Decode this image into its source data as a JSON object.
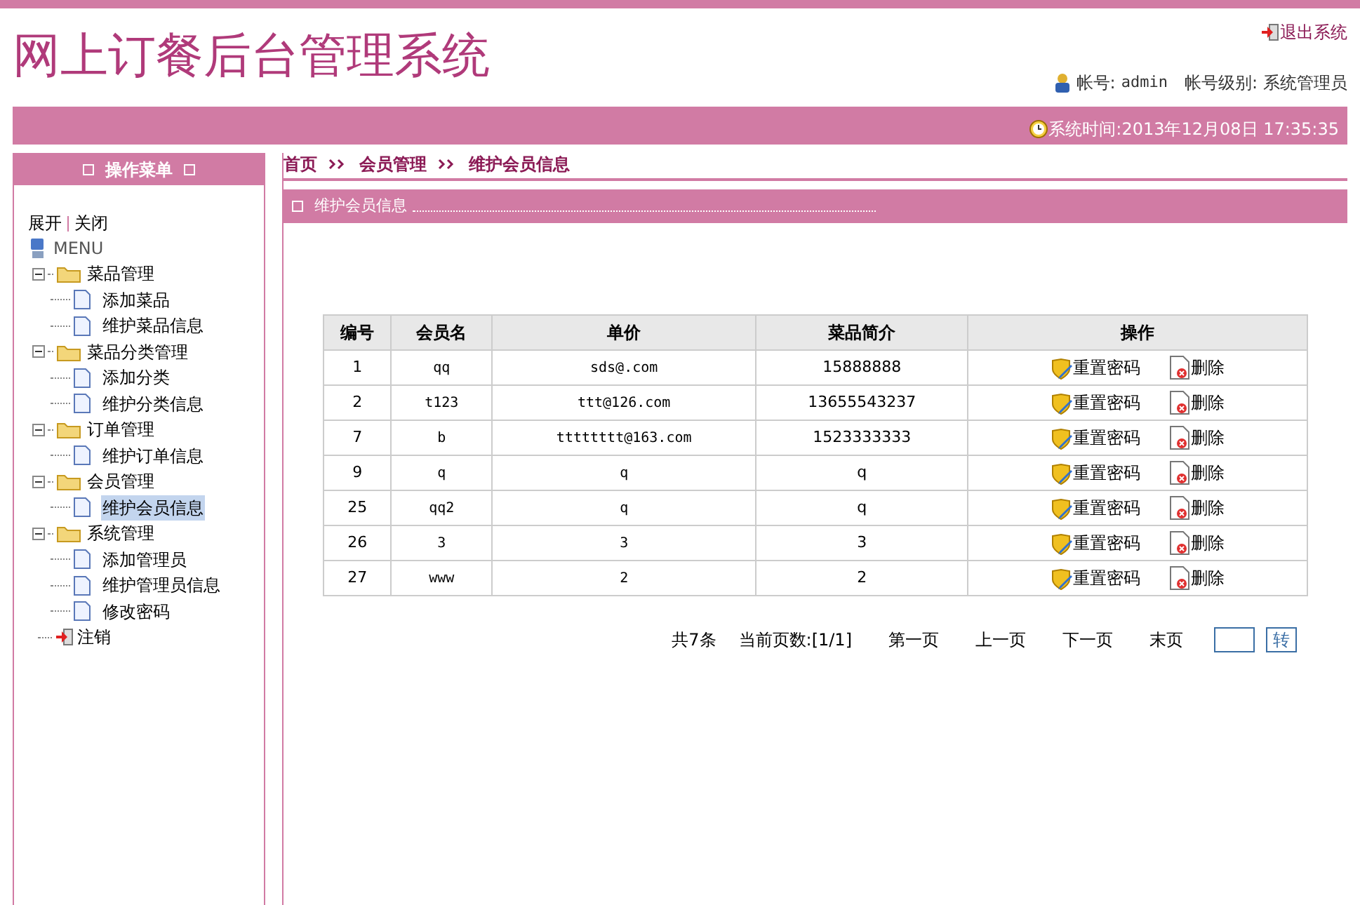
{
  "header": {
    "title": "网上订餐后台管理系统",
    "logout": "退出系统",
    "account_label": "帐号:",
    "account": "admin",
    "level_label": "帐号级别:",
    "level_value": "系统管理员",
    "time": "系统时间:2013年12月08日 17:35:35"
  },
  "sidebar": {
    "title": "操作菜单",
    "expand": "展开",
    "collapse": "关闭",
    "root": "MENU",
    "items": [
      {
        "label": "菜品管理",
        "kind": "folder",
        "expanded": true,
        "children": [
          {
            "label": "添加菜品",
            "selected": false
          },
          {
            "label": "维护菜品信息",
            "selected": false
          }
        ]
      },
      {
        "label": "菜品分类管理",
        "kind": "folder",
        "expanded": true,
        "children": [
          {
            "label": "添加分类",
            "selected": false
          },
          {
            "label": "维护分类信息",
            "selected": false
          }
        ]
      },
      {
        "label": "订单管理",
        "kind": "folder",
        "expanded": true,
        "children": [
          {
            "label": "维护订单信息",
            "selected": false
          }
        ]
      },
      {
        "label": "会员管理",
        "kind": "folder",
        "expanded": true,
        "children": [
          {
            "label": "维护会员信息",
            "selected": true
          }
        ]
      },
      {
        "label": "系统管理",
        "kind": "folder",
        "expanded": true,
        "children": [
          {
            "label": "添加管理员",
            "selected": false
          },
          {
            "label": "维护管理员信息",
            "selected": false
          },
          {
            "label": "修改密码",
            "selected": false
          }
        ]
      },
      {
        "label": "注销",
        "kind": "logout"
      }
    ]
  },
  "breadcrumb": [
    "首页",
    "会员管理",
    "维护会员信息"
  ],
  "panel": {
    "title": "维护会员信息"
  },
  "table": {
    "columns": [
      "编号",
      "会员名",
      "单价",
      "菜品简介",
      "操作"
    ],
    "rows": [
      {
        "cells": [
          "1",
          "qq",
          "sds@.com",
          "15888888"
        ],
        "actions": [
          "重置密码",
          "删除"
        ]
      },
      {
        "cells": [
          "2",
          "t123",
          "ttt@126.com",
          "13655543237"
        ],
        "actions": [
          "重置密码",
          "删除"
        ]
      },
      {
        "cells": [
          "7",
          "b",
          "tttttttt@163.com",
          "1523333333"
        ],
        "actions": [
          "重置密码",
          "删除"
        ]
      },
      {
        "cells": [
          "9",
          "q",
          "q",
          "q"
        ],
        "actions": [
          "重置密码",
          "删除"
        ]
      },
      {
        "cells": [
          "25",
          "qq2",
          "q",
          "q"
        ],
        "actions": [
          "重置密码",
          "删除"
        ]
      },
      {
        "cells": [
          "26",
          "3",
          "3",
          "3"
        ],
        "actions": [
          "重置密码",
          "删除"
        ]
      },
      {
        "cells": [
          "27",
          "www",
          "2",
          "2"
        ],
        "actions": [
          "重置密码",
          "删除"
        ]
      }
    ]
  },
  "pager": {
    "total": "共7条",
    "current": "当前页数:[1/1]",
    "first": "第一页",
    "prev": "上一页",
    "next": "下一页",
    "last": "末页",
    "go": "转"
  }
}
